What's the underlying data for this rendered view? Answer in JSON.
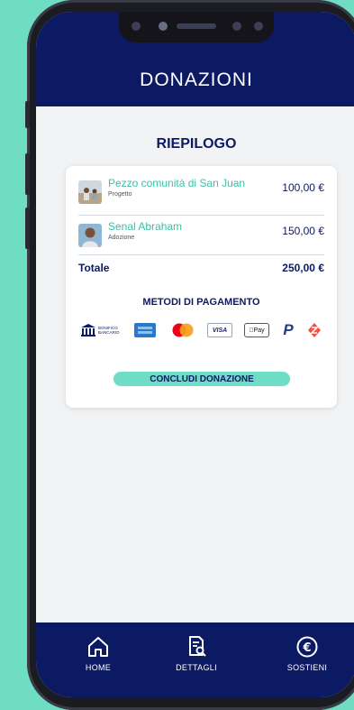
{
  "header": {
    "title": "DONAZIONI"
  },
  "summary": {
    "title": "RIEPILOGO",
    "items": [
      {
        "name": "Pezzo comunità di San Juan",
        "type": "Progetto",
        "price": "100,00 €",
        "thumb_icon": "project-photo"
      },
      {
        "name": "Senal Abraham",
        "type": "Adozione",
        "price": "150,00 €",
        "thumb_icon": "child-photo"
      }
    ],
    "total_label": "Totale",
    "total_value": "250,00 €"
  },
  "payment": {
    "title": "METODI DI PAGAMENTO",
    "methods": [
      {
        "icon": "bank-transfer-icon",
        "label": "BONIFICO BANCARIO"
      },
      {
        "icon": "american-express-icon",
        "label": ""
      },
      {
        "icon": "mastercard-icon",
        "label": ""
      },
      {
        "icon": "visa-icon",
        "label": "VISA"
      },
      {
        "icon": "apple-pay-icon",
        "label": "Pay"
      },
      {
        "icon": "paypal-icon",
        "label": "P"
      },
      {
        "icon": "satispay-icon",
        "label": ""
      }
    ]
  },
  "cta": {
    "label": "CONCLUDI DONAZIONE"
  },
  "nav": [
    {
      "label": "HOME",
      "icon": "home-icon"
    },
    {
      "label": "DETTAGLI",
      "icon": "details-icon"
    },
    {
      "label": "SOSTIENI",
      "icon": "euro-icon"
    }
  ],
  "colors": {
    "navy": "#0c1a64",
    "teal": "#6fdcc4",
    "accent_text": "#3cc0a6"
  }
}
